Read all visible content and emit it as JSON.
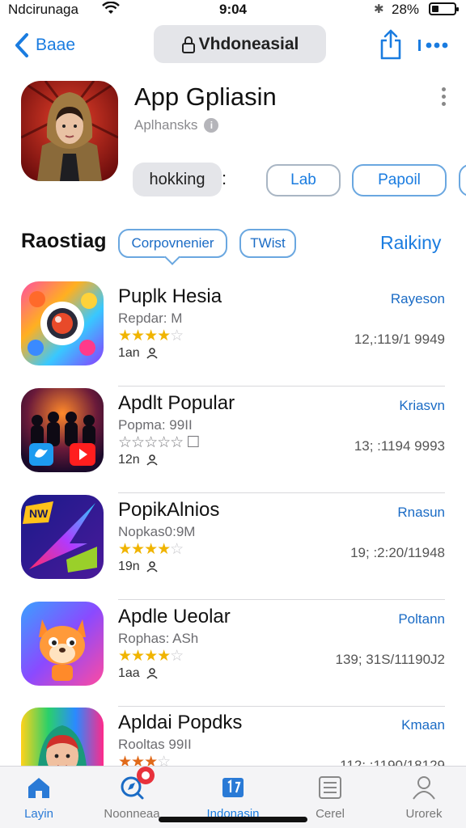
{
  "status": {
    "carrier": "Ndcirunaga",
    "time": "9:04",
    "battery": "28%"
  },
  "nav": {
    "back_label": "Baae",
    "title": "Vhdoneasial"
  },
  "hero": {
    "title": "App Gpliasin",
    "subtitle": "Aplhansks",
    "buttons": {
      "primary": "hokking",
      "colon": ":",
      "lab": "Lab",
      "popul": "Papoil"
    }
  },
  "section": {
    "title": "Raostiag",
    "chip_a": "Corpovnenier",
    "chip_b": "TWist",
    "link": "Raikiny"
  },
  "apps": [
    {
      "name": "Puplk Hesia",
      "meta": "Repdar: M",
      "stars": 4,
      "extra": "1an",
      "action": "Rayeson",
      "count": "12,:119/1 9949"
    },
    {
      "name": "Apdlt Popular",
      "meta": "Popma: 99II",
      "stars": 0,
      "stars_text": "☆☆☆☆☆ ☐",
      "extra": "12n",
      "action": "Kriasvn",
      "count": "13; :1194 9993"
    },
    {
      "name": "PopikAlnios",
      "meta": "Nopkas0:9M",
      "stars": 4,
      "extra": "19n",
      "action": "Rnasun",
      "count": "19; :2:20/11948"
    },
    {
      "name": "Apdle Ueolar",
      "meta": "Rophas: ASh",
      "stars": 4,
      "extra": "1aa",
      "action": "Poltann",
      "count": "139; 31S/11190J2"
    },
    {
      "name": "Apldai Popdks",
      "meta": "Rooltas 99II",
      "stars": 3,
      "extra": "",
      "action": "Kmaan",
      "count": "112; :1190/18129"
    }
  ],
  "tabs": [
    {
      "label": "Layin",
      "icon": "home-icon"
    },
    {
      "label": "Noonneaa",
      "icon": "discover-icon"
    },
    {
      "label": "Indonasin",
      "icon": "apps-icon"
    },
    {
      "label": "Cerel",
      "icon": "list-icon"
    },
    {
      "label": "Urorek",
      "icon": "person-icon"
    }
  ],
  "colors": {
    "accent": "#1a7ce0",
    "star": "#f0b400",
    "badge": "#e8323c"
  }
}
